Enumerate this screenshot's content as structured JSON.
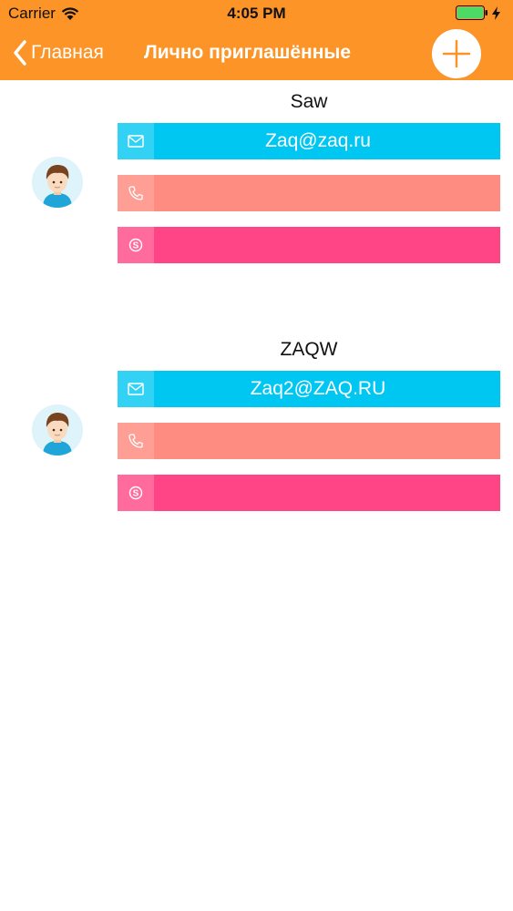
{
  "status_bar": {
    "carrier": "Carrier",
    "time": "4:05 PM"
  },
  "nav": {
    "back_label": "Главная",
    "title": "Лично приглашённые"
  },
  "colors": {
    "header": "#FD9427",
    "email": "#00C6F2",
    "phone": "#FF8C80",
    "skype": "#FF4585",
    "battery": "#4CD964"
  },
  "contacts": [
    {
      "name": "Saw",
      "email": "Zaq@zaq.ru",
      "phone": "",
      "skype": ""
    },
    {
      "name": "ZAQW",
      "email": "Zaq2@ZAQ.RU",
      "phone": "",
      "skype": ""
    }
  ]
}
